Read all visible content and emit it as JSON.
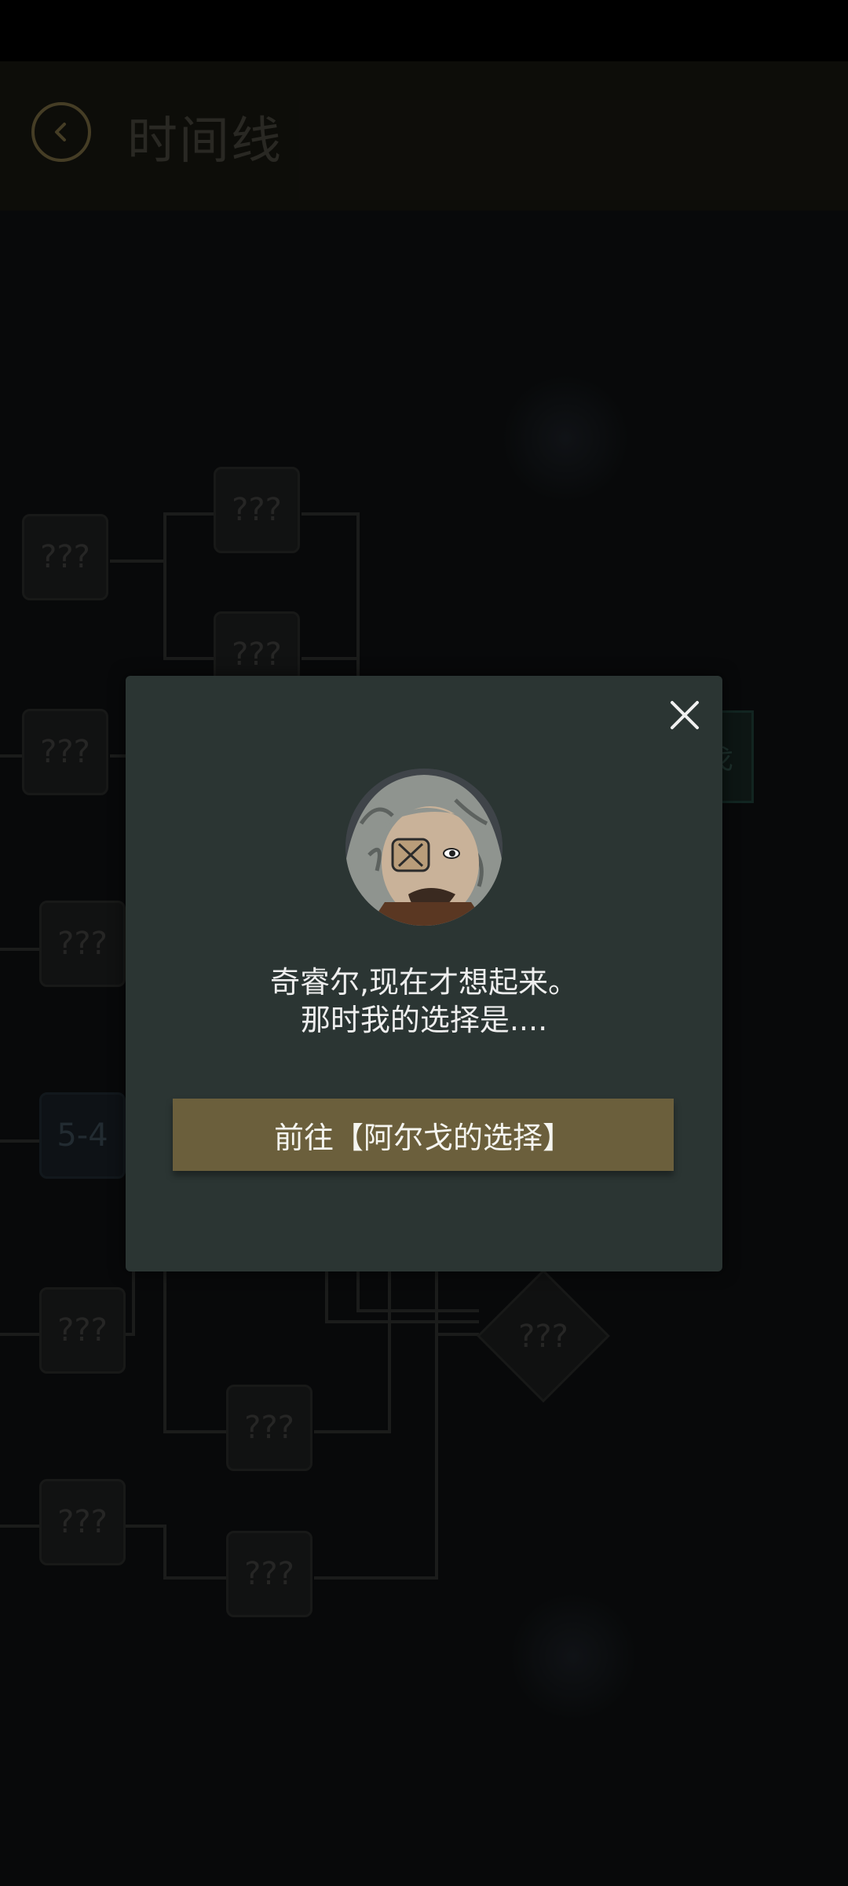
{
  "header": {
    "title": "时间线",
    "back_icon": "chevron-left-icon"
  },
  "timeline": {
    "nodes": [
      {
        "label": "???"
      },
      {
        "label": "???"
      },
      {
        "label": "???"
      },
      {
        "label": "???"
      },
      {
        "label": "???"
      },
      {
        "label": "5-4"
      },
      {
        "label": "???"
      },
      {
        "label": "???"
      },
      {
        "label": "???"
      },
      {
        "label": "???"
      },
      {
        "label": "???"
      }
    ],
    "partial_node_label": "戈"
  },
  "dialog": {
    "message_line1": "奇睿尔,现在才想起来。",
    "message_line2": "那时我的选择是....",
    "button_label": "前往【阿尔戈的选择】",
    "avatar_icon": "character-portrait",
    "close_icon": "close-icon"
  },
  "colors": {
    "modal_bg": "#2b3533",
    "button_bg": "#6b5f3c",
    "accent_gold": "#6b5e3a"
  }
}
